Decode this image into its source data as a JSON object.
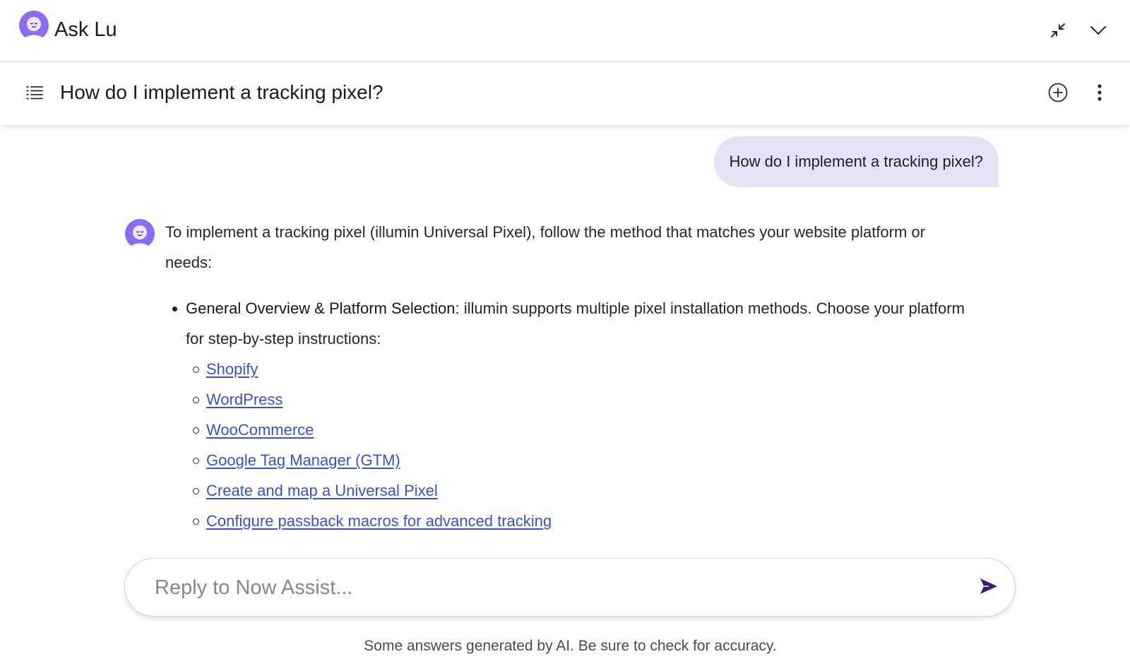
{
  "header": {
    "app_title": "Ask Lu",
    "logo_icon": "lu-avatar-icon",
    "collapse_icon": "minimize-icon",
    "chevron_icon": "chevron-down-icon"
  },
  "conversation": {
    "title": "How do I implement a tracking pixel?",
    "menu_icon": "list-menu-icon",
    "new_chat_icon": "plus-circle-icon",
    "more_icon": "more-vertical-icon"
  },
  "messages": {
    "user_message": "How do I implement a tracking pixel?",
    "bot_intro": "To implement a tracking pixel (illumin Universal Pixel), follow the method that matches your website platform or needs:",
    "bullet_heading": "General Overview & Platform Selection",
    "bullet_text": ": illumin supports multiple pixel installation methods. Choose your platform for step-by-step instructions:",
    "links": [
      "Shopify",
      "WordPress",
      "WooCommerce",
      "Google Tag Manager (GTM)",
      "Create and map a Universal Pixel",
      "Configure passback macros for advanced tracking"
    ]
  },
  "composer": {
    "placeholder": "Reply to Now Assist...",
    "value": "",
    "send_icon": "send-icon"
  },
  "footer": {
    "disclaimer": "Some answers generated by AI. Be sure to check for accuracy."
  },
  "colors": {
    "accent_purple": "#8b6bf2",
    "user_bubble": "#e4e3f5",
    "link_blue": "#3a52c9",
    "send_purple": "#3d1a78"
  }
}
